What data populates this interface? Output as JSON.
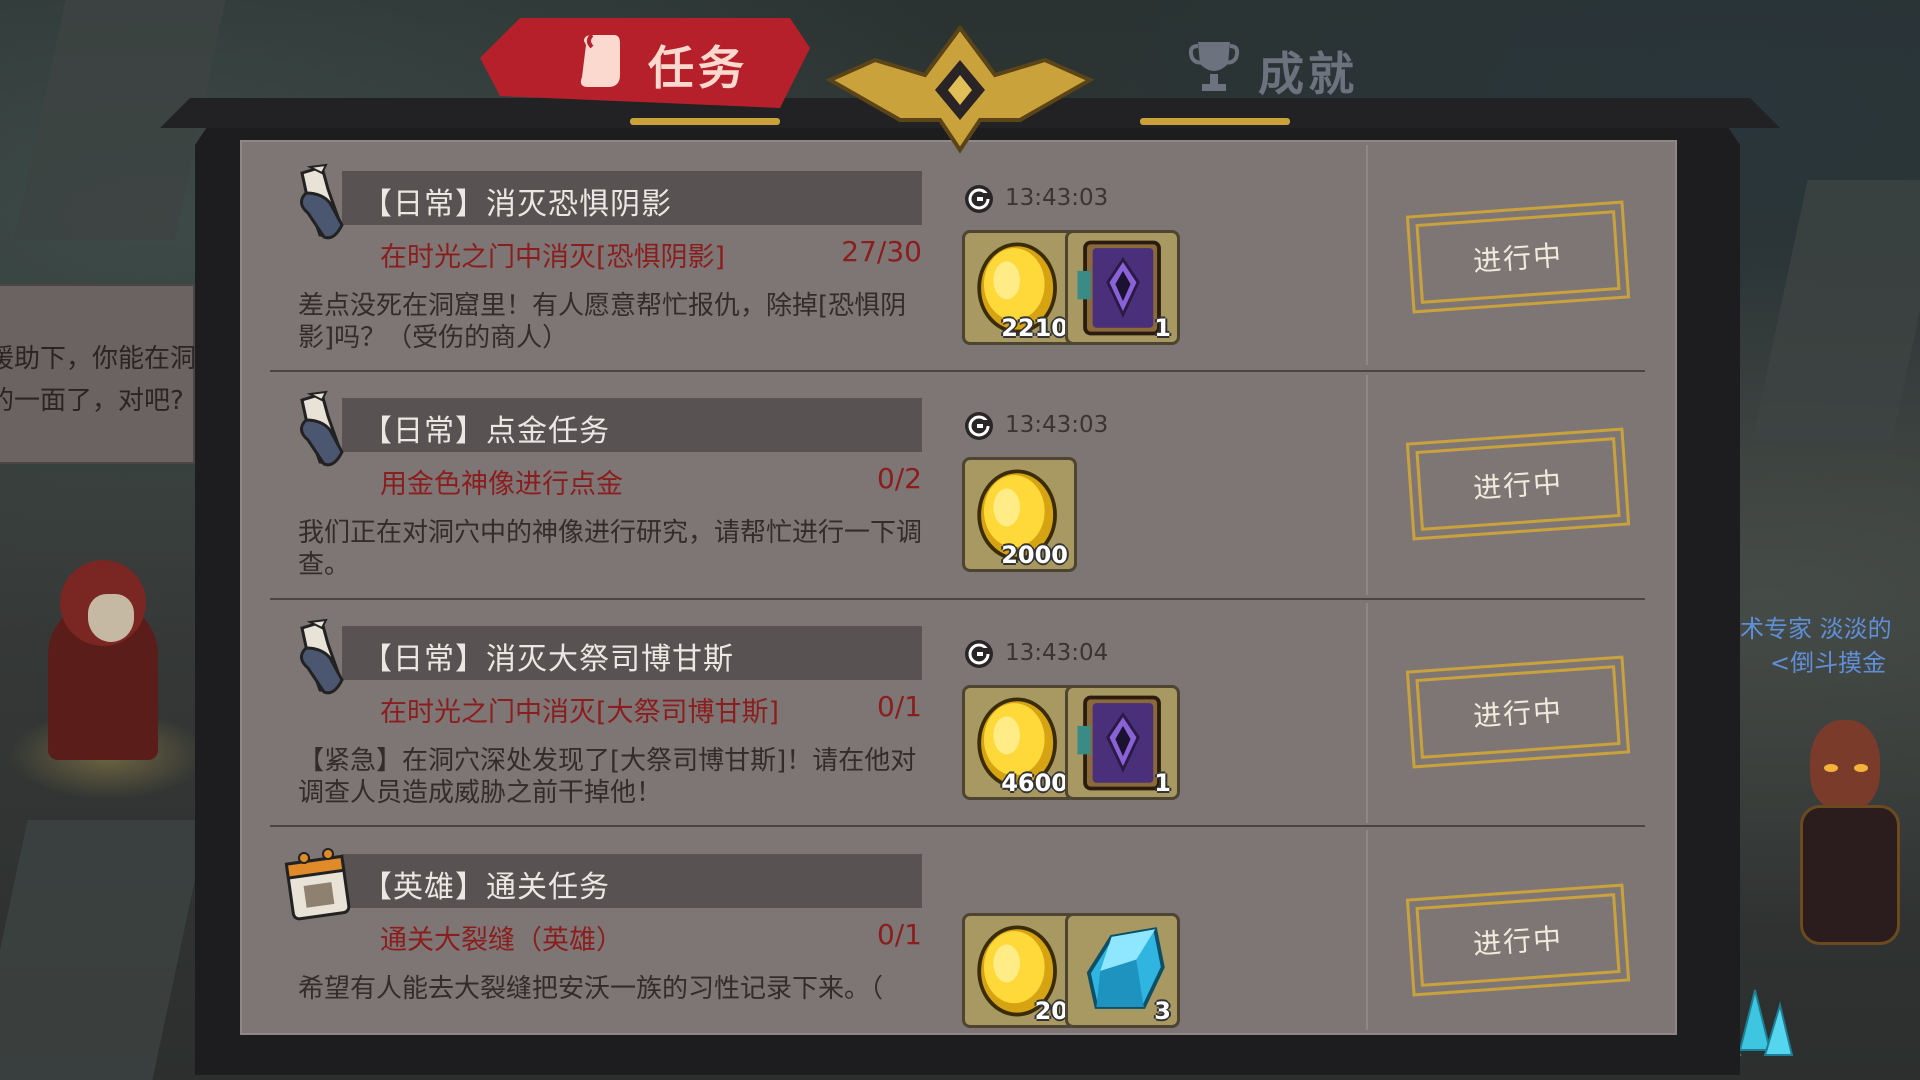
{
  "tabs": {
    "task_label": "任务",
    "achievement_label": "成就"
  },
  "background": {
    "dialog_lines": [
      "援助下，你能在洞",
      "的一面了，对吧?"
    ],
    "chat_lines": [
      "术专家 淡淡的",
      "<倒斗摸金"
    ]
  },
  "colors": {
    "panel": "#7e7675",
    "active_tab": "#b5202a",
    "objective_text": "#8a1e1e",
    "gold_frame": "#c9a23c"
  },
  "quests": [
    {
      "title": "【日常】消灭恐惧阴影",
      "objective": "在时光之门中消灭[恐惧阴影]",
      "progress": "27/30",
      "description": "差点没死在洞窟里！有人愿意帮忙报仇，除掉[恐惧阴影]吗？（受伤的商人）",
      "timer": "13:43:03",
      "icon": "scroll-icon",
      "rewards": [
        {
          "type": "gold-coin-icon",
          "qty": "2210"
        },
        {
          "type": "purple-book-icon",
          "qty": "1"
        }
      ],
      "status": "进行中"
    },
    {
      "title": "【日常】点金任务",
      "objective": "用金色神像进行点金",
      "progress": "0/2",
      "description": "我们正在对洞穴中的神像进行研究，请帮忙进行一下调查。",
      "timer": "13:43:03",
      "icon": "scroll-icon",
      "rewards": [
        {
          "type": "gold-coin-icon",
          "qty": "2000"
        }
      ],
      "status": "进行中"
    },
    {
      "title": "【日常】消灭大祭司博甘斯",
      "objective": "在时光之门中消灭[大祭司博甘斯]",
      "progress": "0/1",
      "description": "【紧急】在洞穴深处发现了[大祭司博甘斯]！请在他对调查人员造成威胁之前干掉他！",
      "timer": "13:43:04",
      "icon": "scroll-icon",
      "rewards": [
        {
          "type": "gold-coin-icon",
          "qty": "4600"
        },
        {
          "type": "purple-book-icon",
          "qty": "1"
        }
      ],
      "status": "进行中"
    },
    {
      "title": "【英雄】通关任务",
      "objective": "通关大裂缝（英雄）",
      "progress": "0/1",
      "description": "希望有人能去大裂缝把安沃一族的习性记录下来。（",
      "timer": "",
      "icon": "calendar-icon",
      "rewards": [
        {
          "type": "gold-coin-icon",
          "qty": "20"
        },
        {
          "type": "blue-crystal-icon",
          "qty": "3"
        }
      ],
      "status": "进行中"
    }
  ]
}
